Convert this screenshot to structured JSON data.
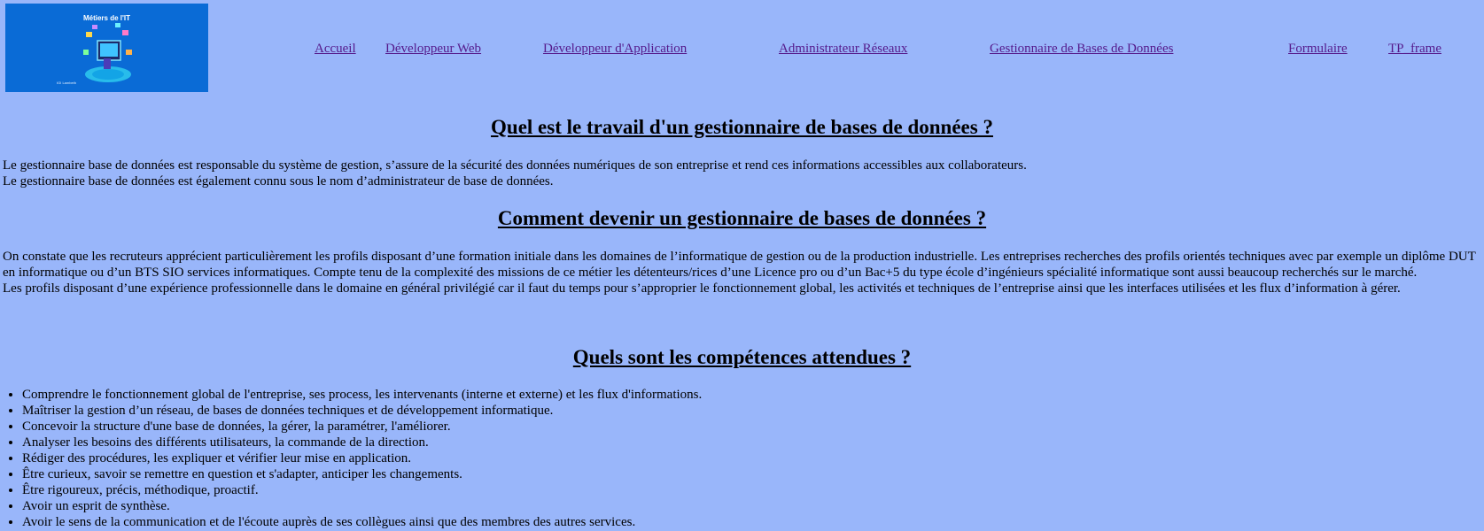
{
  "logo": {
    "title": "Métiers de l'IT",
    "credit": "IGI Lambeth"
  },
  "nav": {
    "items": [
      {
        "label": "Accueil"
      },
      {
        "label": "Développeur Web"
      },
      {
        "label": "Développeur d'Application"
      },
      {
        "label": "Administrateur Réseaux"
      },
      {
        "label": "Gestionnaire de Bases de Données"
      },
      {
        "label": "Formulaire"
      },
      {
        "label": "TP_frame"
      }
    ]
  },
  "sections": {
    "travail": {
      "heading": "Quel est le travail d'un gestionnaire de bases de données ?",
      "lines": [
        "Le gestionnaire base de données est responsable du système de gestion, s’assure de la sécurité des données numériques de son entreprise et rend ces informations accessibles aux collaborateurs.",
        "Le gestionnaire base de données est également connu sous le nom d’administrateur de base de données."
      ]
    },
    "devenir": {
      "heading": "Comment devenir un gestionnaire de bases de données ?",
      "lines": [
        "On constate que les recruteurs apprécient particulièrement les profils disposant d’une formation initiale dans les domaines de l’informatique de gestion ou de la production industrielle. Les entreprises recherches des profils orientés techniques avec par exemple un diplôme DUT en informatique ou d’un BTS SIO services informatiques. Compte tenu de la complexité des missions de ce métier les détenteurs/rices d’une Licence pro ou d’un Bac+5 du type école d’ingénieurs spécialité informatique sont aussi beaucoup recherchés sur le marché.",
        "Les profils disposant d’une expérience professionnelle dans le domaine en général privilégié car il faut du temps pour s’approprier le fonctionnement global, les activités et techniques de l’entreprise ainsi que les interfaces utilisées et les flux d’information à gérer."
      ]
    },
    "competences": {
      "heading": "Quels sont les compétences attendues ?",
      "items": [
        "Comprendre le fonctionnement global de l'entreprise, ses process, les intervenants (interne et externe) et les flux d'informations.",
        "Maîtriser la gestion d’un réseau, de bases de données techniques et de développement informatique.",
        "Concevoir la structure d'une base de données, la gérer, la paramétrer, l'améliorer.",
        "Analyser les besoins des différents utilisateurs, la commande de la direction.",
        "Rédiger des procédures, les expliquer et vérifier leur mise en application.",
        "Être curieux, savoir se remettre en question et s'adapter, anticiper les changements.",
        "Être rigoureux, précis, méthodique, proactif.",
        "Avoir un esprit de synthèse.",
        "Avoir le sens de la communication et de l'écoute auprès de ses collègues ainsi que des membres des autres services."
      ]
    }
  }
}
